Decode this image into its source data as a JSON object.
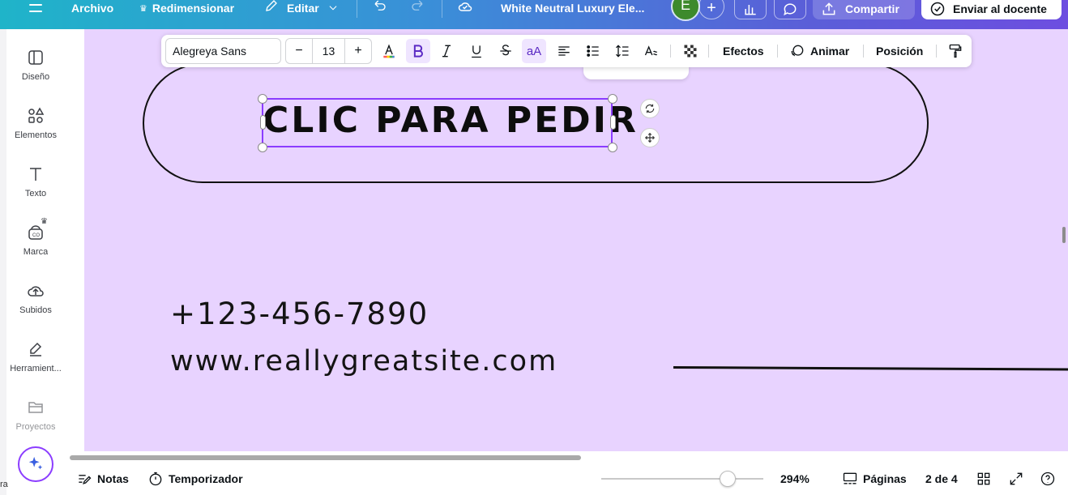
{
  "topbar": {
    "menu_file": "Archivo",
    "resize": "Redimensionar",
    "edit": "Editar",
    "doc_title": "White Neutral Luxury Ele...",
    "avatar_initial": "E",
    "share": "Compartir",
    "send_teacher": "Enviar al docente"
  },
  "sidebar": {
    "items": [
      {
        "label": "Diseño",
        "icon": "layout-icon"
      },
      {
        "label": "Elementos",
        "icon": "shapes-icon"
      },
      {
        "label": "Texto",
        "icon": "text-icon"
      },
      {
        "label": "Marca",
        "icon": "brand-icon"
      },
      {
        "label": "Subidos",
        "icon": "upload-cloud-icon"
      },
      {
        "label": "Herramient...",
        "icon": "tools-icon"
      },
      {
        "label": "Proyectos",
        "icon": "folder-icon"
      }
    ]
  },
  "text_toolbar": {
    "font_name": "Alegreya Sans",
    "font_size": "13",
    "decrease": "−",
    "increase": "+",
    "effects": "Efectos",
    "animate": "Animar",
    "position": "Posición"
  },
  "canvas": {
    "headline": "CLIC PARA PEDIR",
    "phone": "+123-456-7890",
    "website": "www.reallygreatsite.com",
    "background_color": "#e8d3ff"
  },
  "bottombar": {
    "notes": "Notas",
    "timer": "Temporizador",
    "zoom": "294%",
    "pages": "Páginas",
    "page_count": "2 de 4",
    "zoom_fraction": 0.78
  },
  "edge_text": "ra",
  "colors": {
    "accent": "#8b3dff",
    "topbar_start": "#1fb4c9",
    "topbar_end": "#6d4ee0"
  }
}
